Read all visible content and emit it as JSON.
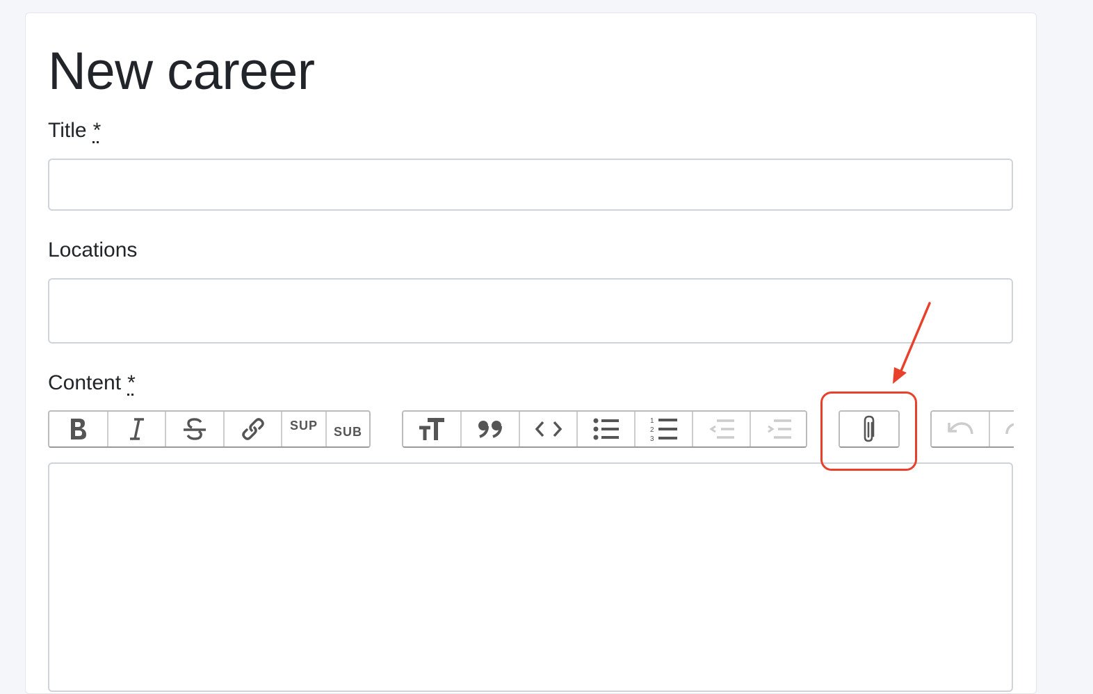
{
  "page": {
    "title": "New career"
  },
  "form": {
    "title_label": "Title",
    "title_required": "*",
    "title_value": "",
    "locations_label": "Locations",
    "locations_value": "",
    "content_label": "Content",
    "content_required": "*"
  },
  "toolbar": {
    "text_tools": [
      "bold",
      "italic",
      "strike",
      "link",
      "SUP",
      "SUB"
    ],
    "sup_label": "SUP",
    "sub_label": "SUB",
    "block_tools": [
      "heading",
      "quote",
      "code",
      "bullet-list",
      "number-list",
      "decrease-indent",
      "increase-indent"
    ],
    "file_tools": [
      "attach-files"
    ],
    "history_tools": [
      "undo",
      "redo"
    ]
  },
  "annotation": {
    "color": "#e8402b",
    "target": "attach-files-button"
  },
  "colors": {
    "background": "#f5f6f9",
    "card": "#ffffff",
    "border": "#ced4da",
    "annotation": "#e8402b"
  }
}
